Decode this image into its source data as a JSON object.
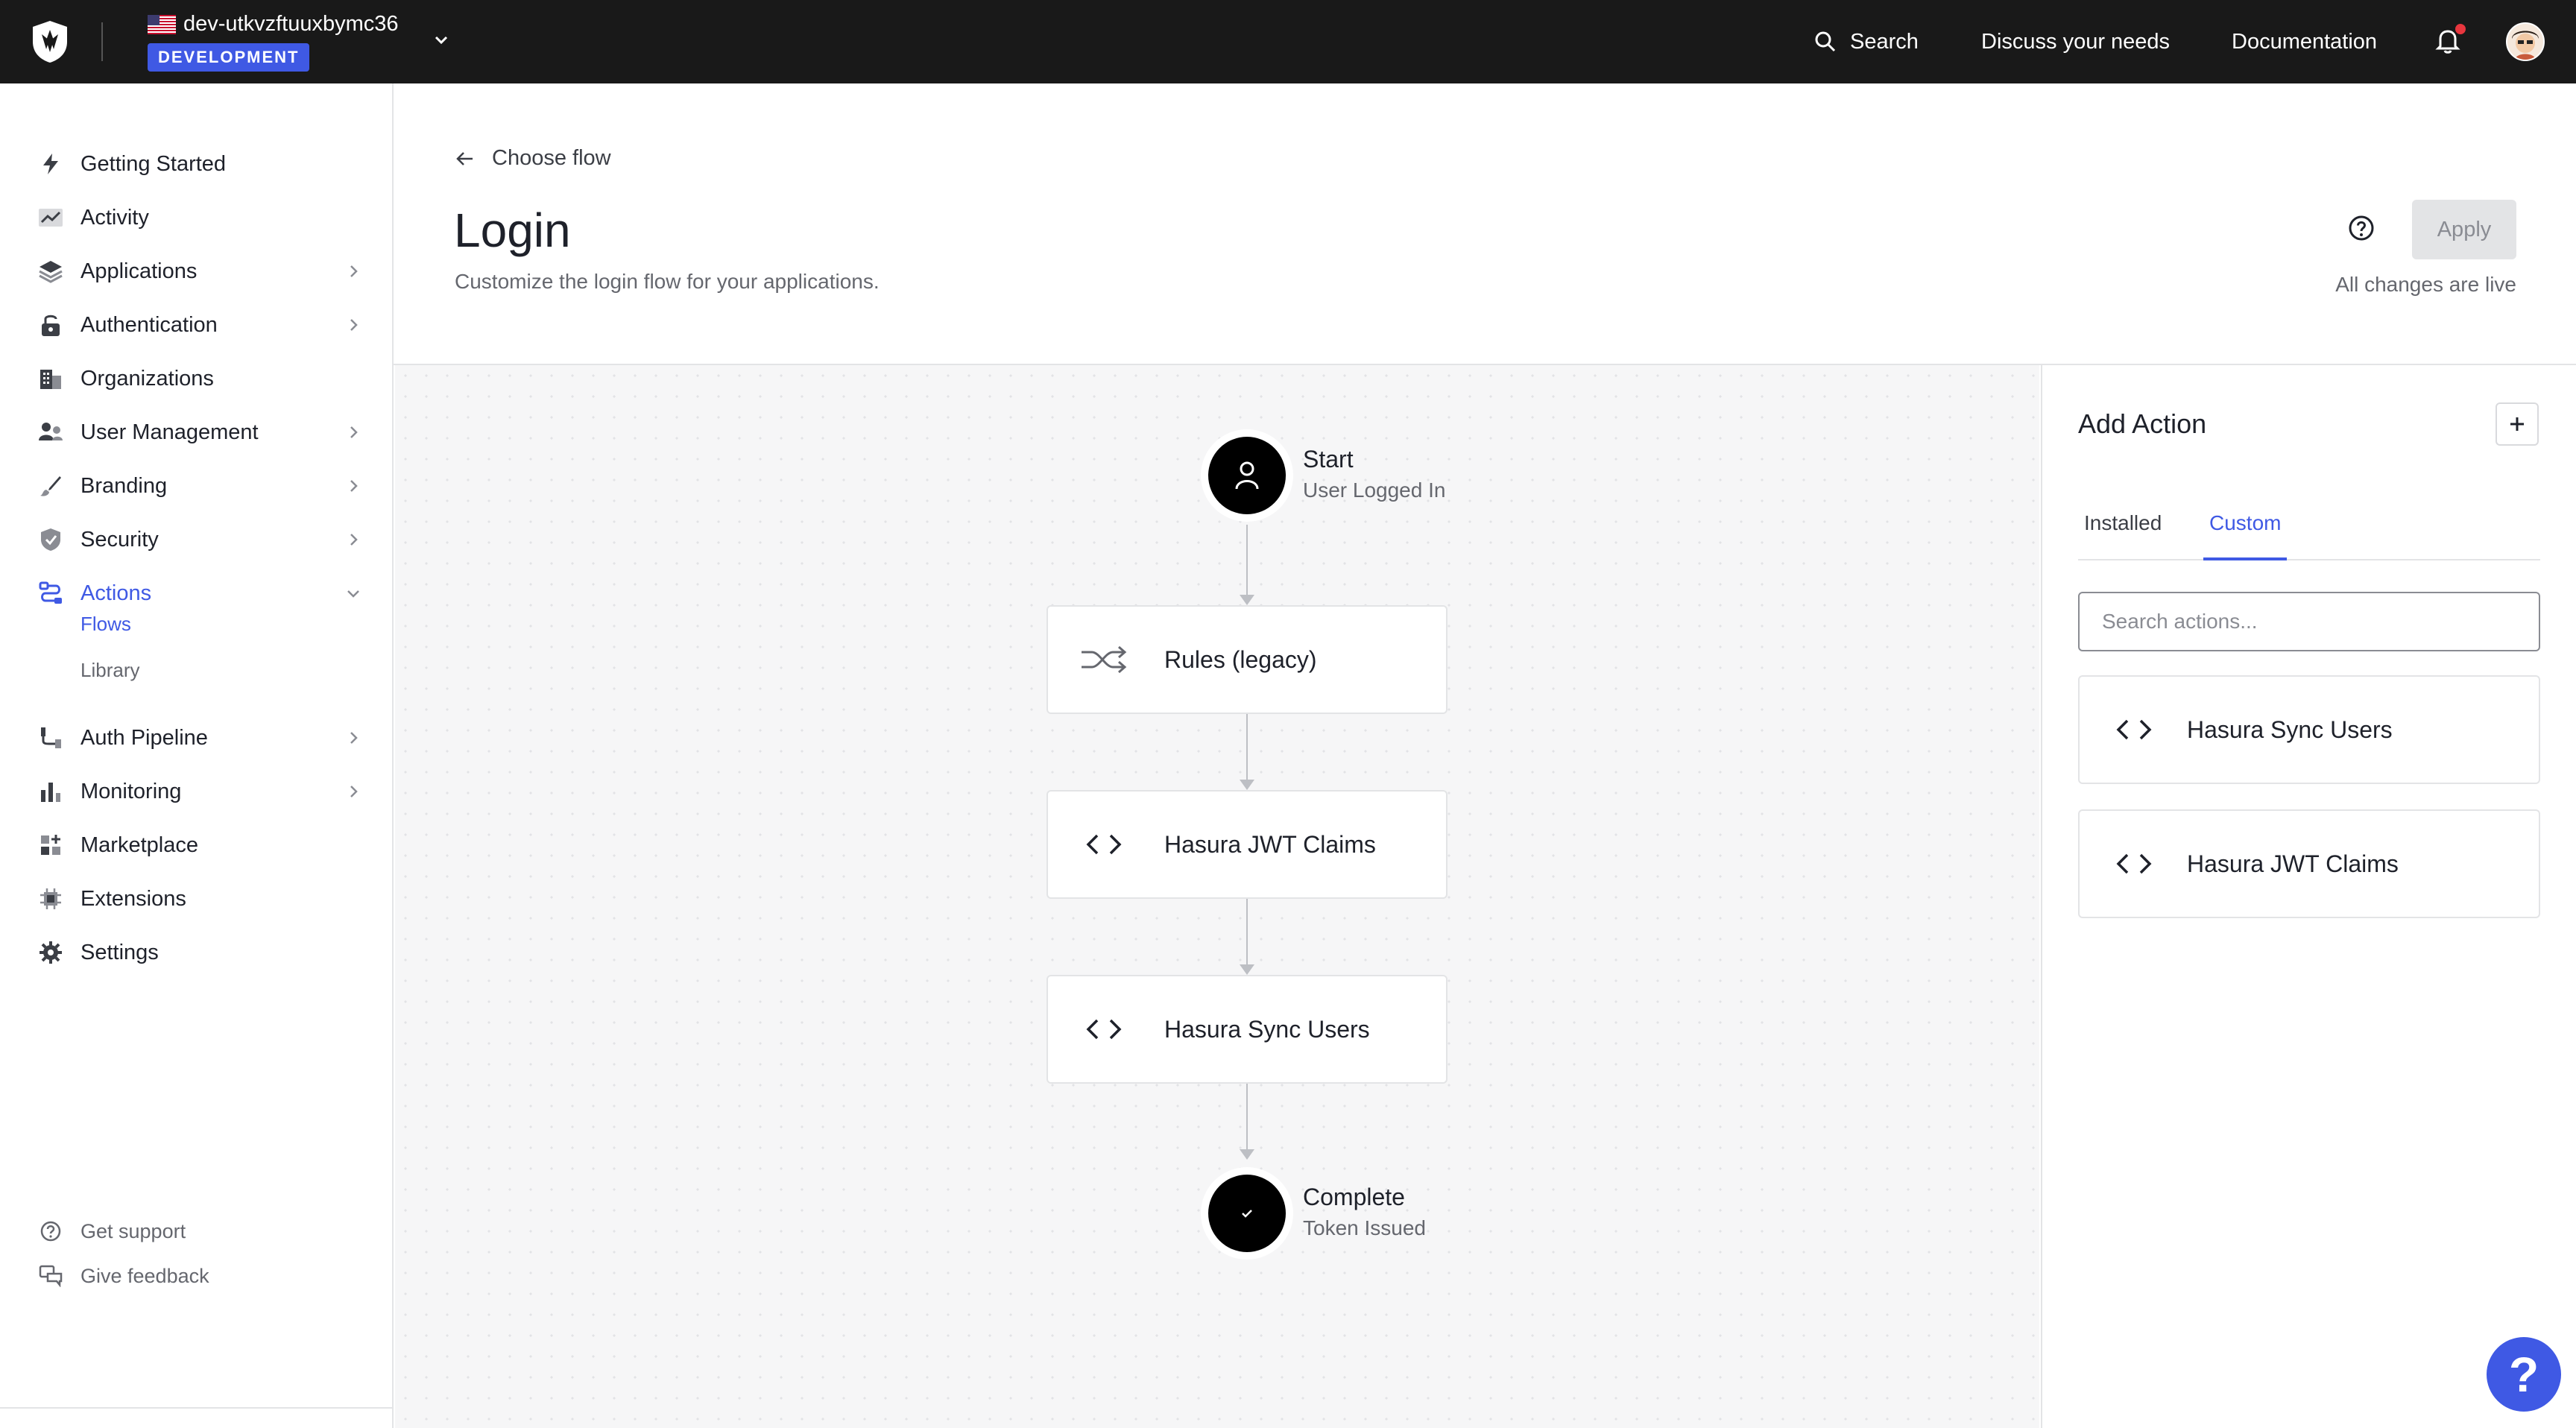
{
  "topbar": {
    "tenant_name": "dev-utkvzftuuxbymc36",
    "environment_badge": "DEVELOPMENT",
    "search_label": "Search",
    "discuss_label": "Discuss your needs",
    "docs_label": "Documentation"
  },
  "sidebar": {
    "items": [
      {
        "label": "Getting Started",
        "icon": "lightning-icon",
        "has_chevron": false
      },
      {
        "label": "Activity",
        "icon": "activity-chart-icon",
        "has_chevron": false
      },
      {
        "label": "Applications",
        "icon": "layers-icon",
        "has_chevron": true
      },
      {
        "label": "Authentication",
        "icon": "lock-icon",
        "has_chevron": true
      },
      {
        "label": "Organizations",
        "icon": "building-icon",
        "has_chevron": false
      },
      {
        "label": "User Management",
        "icon": "users-icon",
        "has_chevron": true
      },
      {
        "label": "Branding",
        "icon": "brush-icon",
        "has_chevron": true
      },
      {
        "label": "Security",
        "icon": "shield-icon",
        "has_chevron": true
      },
      {
        "label": "Actions",
        "icon": "actions-icon",
        "has_chevron": true,
        "expanded": true
      },
      {
        "label": "Auth Pipeline",
        "icon": "pipeline-icon",
        "has_chevron": true
      },
      {
        "label": "Monitoring",
        "icon": "bar-chart-icon",
        "has_chevron": true
      },
      {
        "label": "Marketplace",
        "icon": "grid-plus-icon",
        "has_chevron": false
      },
      {
        "label": "Extensions",
        "icon": "chip-icon",
        "has_chevron": false
      },
      {
        "label": "Settings",
        "icon": "gear-icon",
        "has_chevron": false
      }
    ],
    "subitems": [
      {
        "label": "Flows",
        "active": true
      },
      {
        "label": "Library",
        "active": false
      }
    ],
    "footer": {
      "support_label": "Get support",
      "feedback_label": "Give feedback"
    }
  },
  "header": {
    "back_label": "Choose flow",
    "title": "Login",
    "subtitle": "Customize the login flow for your applications.",
    "apply_label": "Apply",
    "status": "All changes are live"
  },
  "flow": {
    "start": {
      "title": "Start",
      "subtitle": "User Logged In"
    },
    "steps": [
      {
        "label": "Rules (legacy)",
        "icon": "shuffle-icon"
      },
      {
        "label": "Hasura JWT Claims",
        "icon": "code-icon"
      },
      {
        "label": "Hasura Sync Users",
        "icon": "code-icon"
      }
    ],
    "end": {
      "title": "Complete",
      "subtitle": "Token Issued"
    }
  },
  "panel": {
    "title": "Add Action",
    "tabs": [
      {
        "label": "Installed",
        "active": false
      },
      {
        "label": "Custom",
        "active": true
      }
    ],
    "search_placeholder": "Search actions...",
    "actions": [
      {
        "label": "Hasura Sync Users",
        "icon": "code-icon"
      },
      {
        "label": "Hasura JWT Claims",
        "icon": "code-icon"
      }
    ]
  },
  "help_fab": "?",
  "colors": {
    "accent": "#3f59e4",
    "topbar_bg": "#191919",
    "canvas_bg": "#f6f6f7",
    "notification_dot": "#e8363e"
  }
}
